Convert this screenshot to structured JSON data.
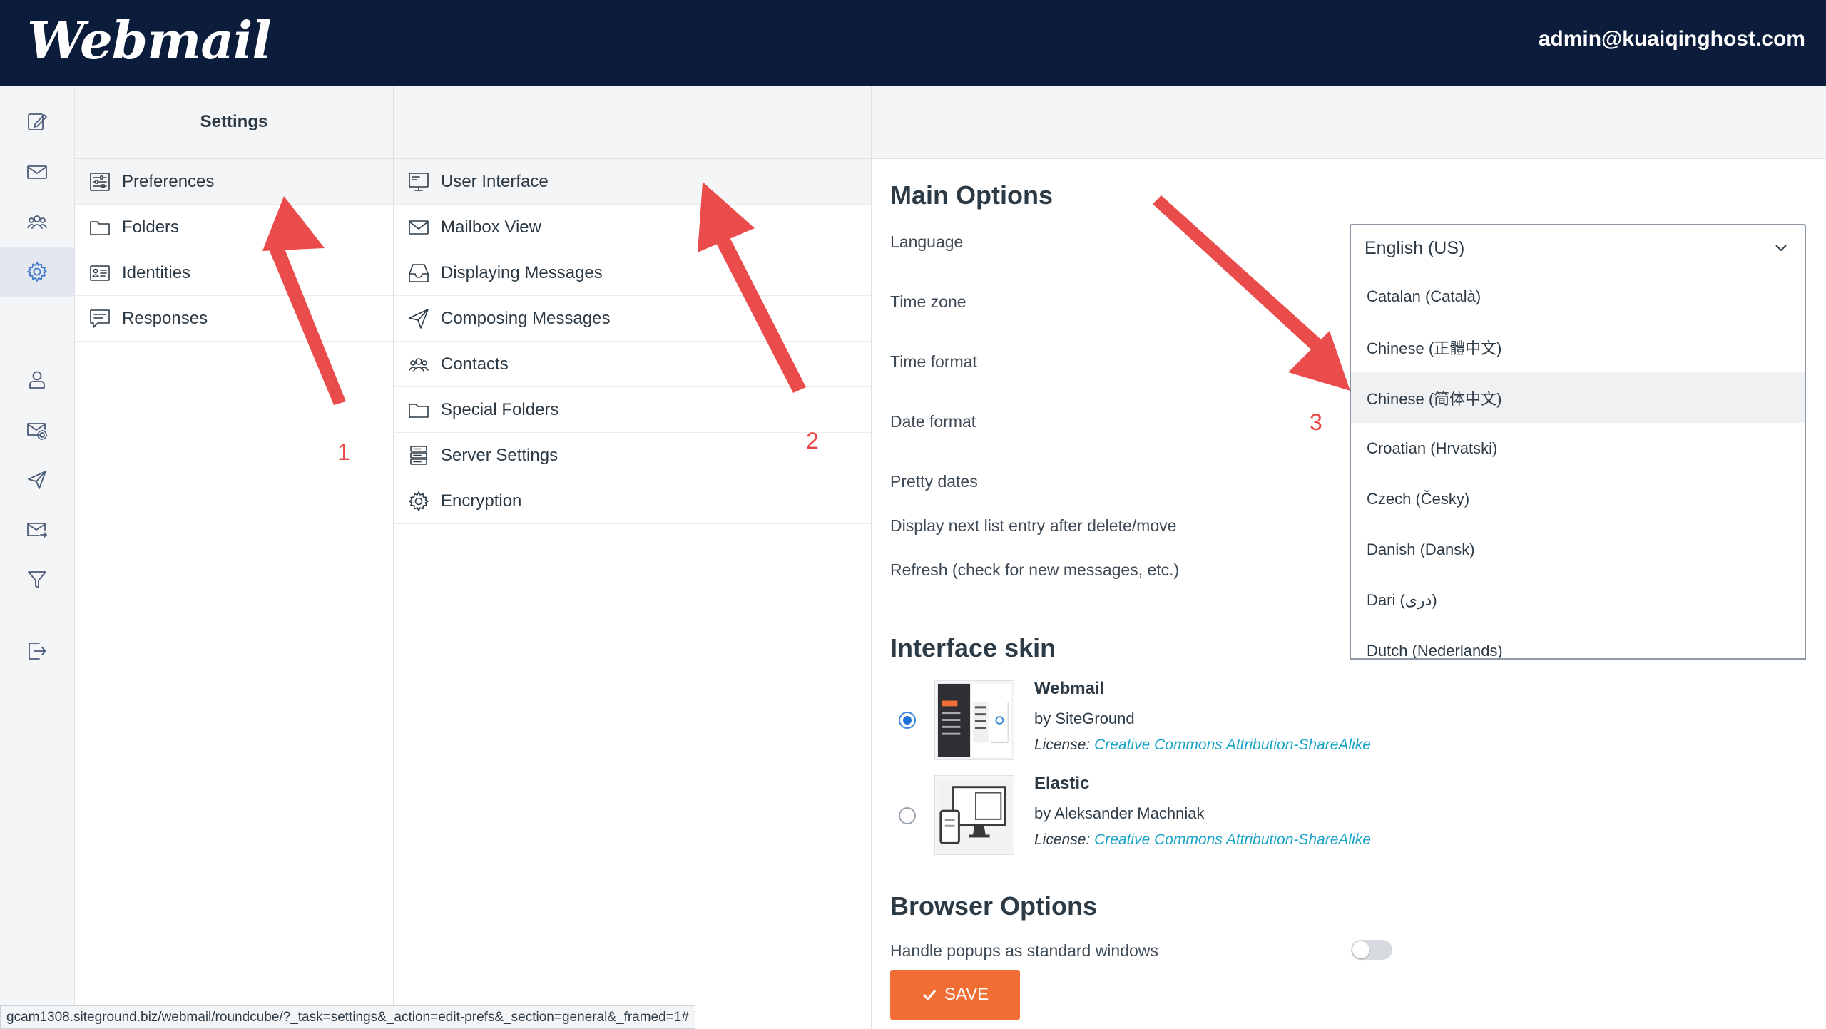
{
  "header": {
    "logo": "Webmail",
    "user_email": "admin@kuaiqinghost.com"
  },
  "iconnav": [
    {
      "icon": "compose-icon",
      "active": false
    },
    {
      "icon": "mail-icon",
      "active": false
    },
    {
      "icon": "contacts-icon",
      "active": false
    },
    {
      "icon": "settings-icon",
      "active": true
    },
    {
      "icon": "user-icon",
      "active": false
    },
    {
      "icon": "mail-settings-icon",
      "active": false
    },
    {
      "icon": "send-icon",
      "active": false
    },
    {
      "icon": "forward-mail-icon",
      "active": false
    },
    {
      "icon": "filter-icon",
      "active": false
    },
    {
      "icon": "logout-icon",
      "active": false
    }
  ],
  "settings": {
    "title": "Settings",
    "items": [
      {
        "label": "Preferences",
        "icon": "sliders-icon"
      },
      {
        "label": "Folders",
        "icon": "folder-icon"
      },
      {
        "label": "Identities",
        "icon": "id-card-icon"
      },
      {
        "label": "Responses",
        "icon": "response-icon"
      }
    ]
  },
  "preferences": {
    "items": [
      {
        "label": "User Interface",
        "icon": "monitor-icon"
      },
      {
        "label": "Mailbox View",
        "icon": "envelope-icon"
      },
      {
        "label": "Displaying Messages",
        "icon": "inbox-icon"
      },
      {
        "label": "Composing Messages",
        "icon": "paper-plane-icon"
      },
      {
        "label": "Contacts",
        "icon": "contacts-icon"
      },
      {
        "label": "Special Folders",
        "icon": "folder-icon"
      },
      {
        "label": "Server Settings",
        "icon": "server-icon"
      },
      {
        "label": "Encryption",
        "icon": "gear-icon"
      }
    ]
  },
  "main": {
    "main_options_title": "Main Options",
    "options": [
      "Language",
      "Time zone",
      "Time format",
      "Date format",
      "Pretty dates",
      "Display next list entry after delete/move",
      "Refresh (check for new messages, etc.)"
    ],
    "language": {
      "selected": "English (US)",
      "options": [
        "Catalan (Català)",
        "Chinese (正體中文)",
        "Chinese (简体中文)",
        "Croatian (Hrvatski)",
        "Czech (Česky)",
        "Danish (Dansk)",
        "Dari (ﺩﺭی)",
        "Dutch (Nederlands)"
      ],
      "highlighted_index": 2
    },
    "interface_skin_title": "Interface skin",
    "skins": [
      {
        "name": "Webmail",
        "author": "by SiteGround",
        "license_label": "License:",
        "license_link": "Creative Commons Attribution-ShareAlike",
        "selected": true
      },
      {
        "name": "Elastic",
        "author": "by Aleksander Machniak",
        "license_label": "License:",
        "license_link": "Creative Commons Attribution-ShareAlike",
        "selected": false
      }
    ],
    "browser_options_title": "Browser Options",
    "popup_label": "Handle popups as standard windows",
    "popup_enabled": false,
    "save_label": "SAVE"
  },
  "status_url": "gcam1308.siteground.biz/webmail/roundcube/?_task=settings&_action=edit-prefs&_section=general&_framed=1#",
  "annotations": [
    "1",
    "2",
    "3"
  ],
  "colors": {
    "header_bg": "#0c1c3b",
    "accent": "#f06e34",
    "link": "#19a3c7",
    "annotation": "#e84545"
  }
}
